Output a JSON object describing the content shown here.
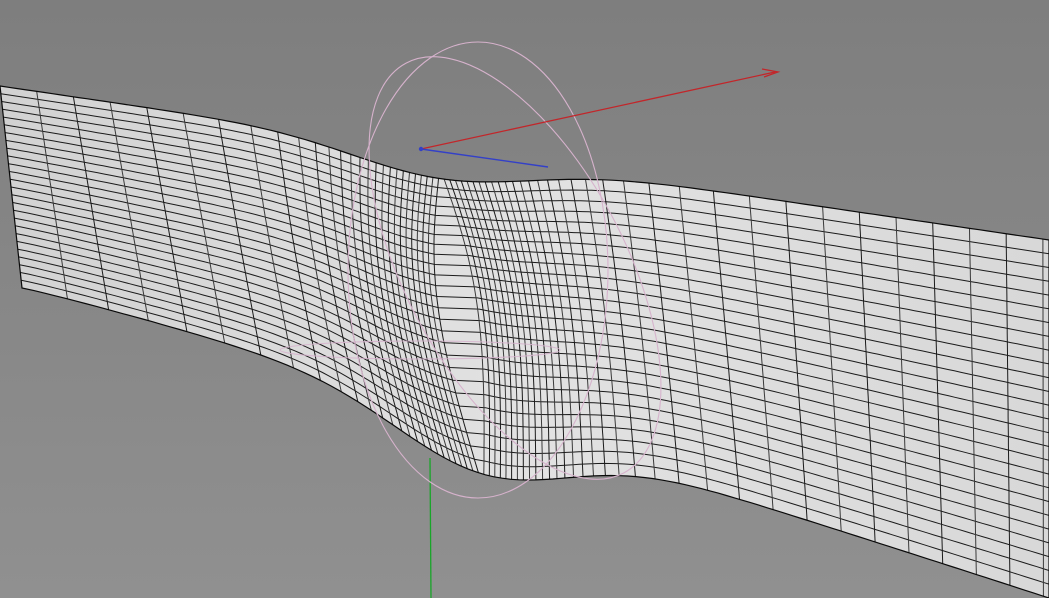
{
  "viewport": {
    "background_color": "#8a8a8a",
    "background_top_color": "#7e7e7e",
    "background_bottom_color": "#909090"
  },
  "mesh": {
    "surface_color": "#dcdcdc",
    "surface_shade_color": "#cfcfcf",
    "wire_color": "#1b1b1b"
  },
  "gizmo": {
    "x_axis_color": "#c2262a",
    "y_axis_color": "#18a628",
    "z_axis_color": "#3340c8",
    "rotation_ring_color": "#d6b2cc",
    "pivot_color": "#3340c8"
  },
  "icons": {
    "translate_gizmo": "move-gizmo-icon",
    "rotate_gizmo": "rotate-gizmo-icon"
  }
}
